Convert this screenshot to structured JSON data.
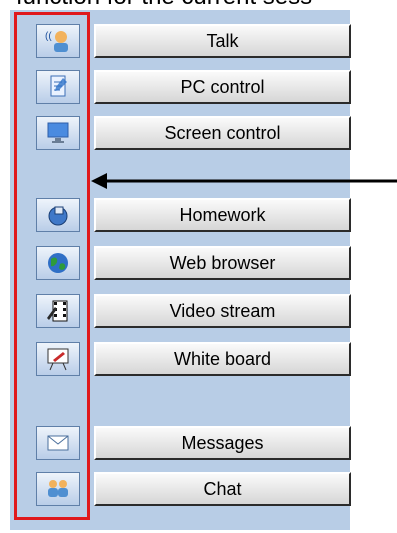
{
  "caption": "function for the current sess",
  "panel": {
    "items": [
      {
        "label": "Talk",
        "icon": "talk-icon"
      },
      {
        "label": "PC control",
        "icon": "pc-control-icon"
      },
      {
        "label": "Screen control",
        "icon": "screen-control-icon"
      },
      {
        "label": "Homework",
        "icon": "homework-icon"
      },
      {
        "label": "Web browser",
        "icon": "web-browser-icon"
      },
      {
        "label": "Video stream",
        "icon": "video-stream-icon"
      },
      {
        "label": "White board",
        "icon": "white-board-icon"
      },
      {
        "label": "Messages",
        "icon": "messages-icon"
      },
      {
        "label": "Chat",
        "icon": "chat-icon"
      }
    ]
  },
  "colors": {
    "panel_bg": "#b8cde6",
    "highlight_frame": "#e0191c",
    "arrow": "#000000"
  }
}
